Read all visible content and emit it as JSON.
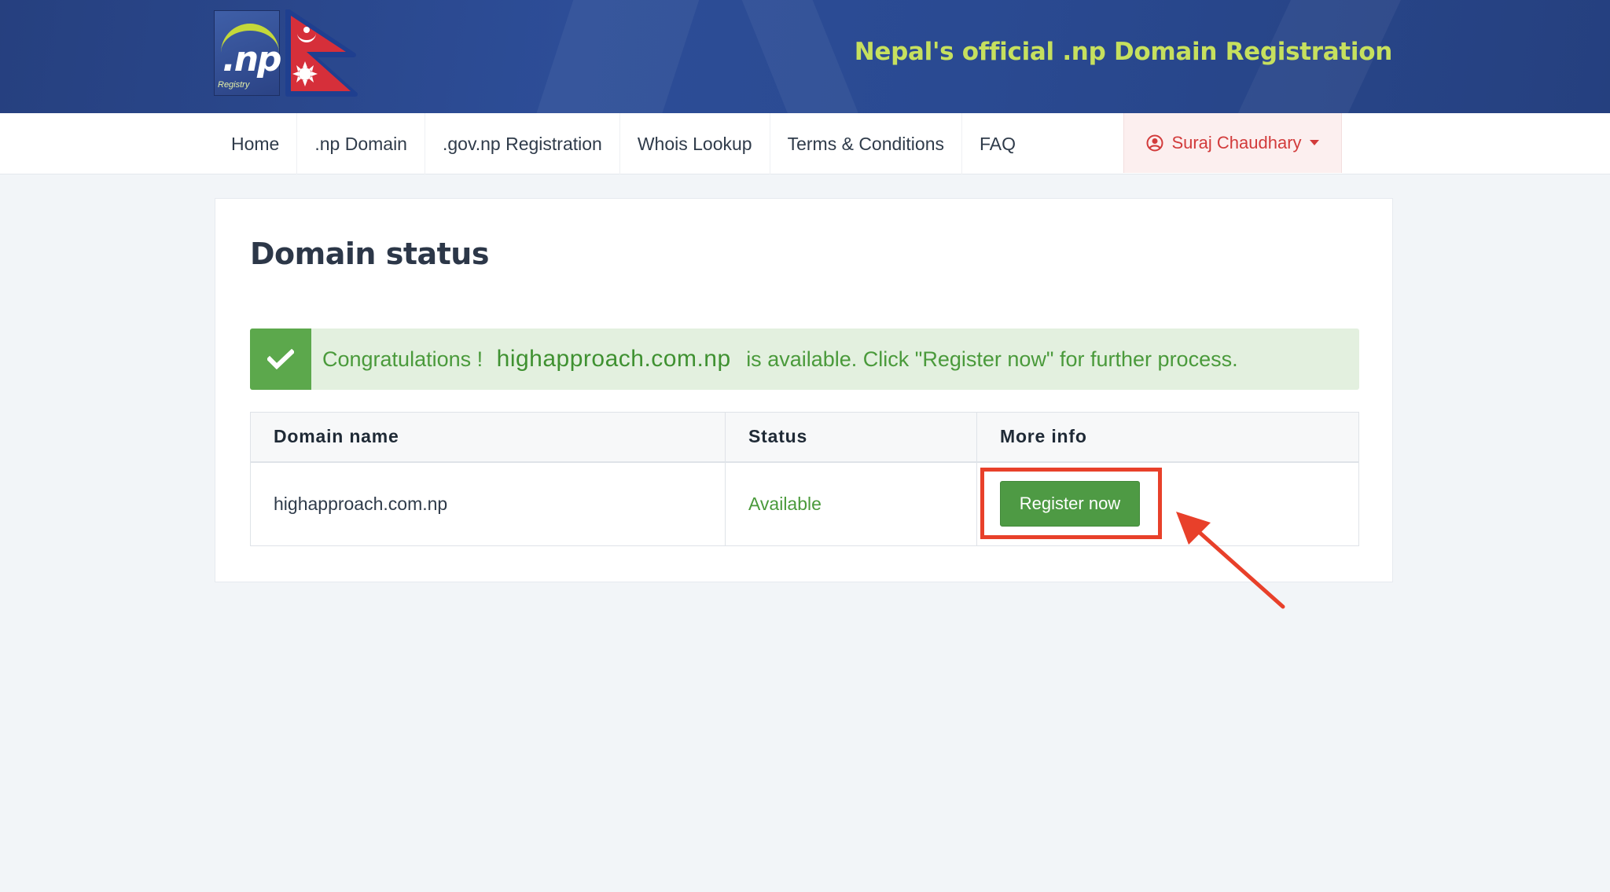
{
  "header": {
    "logo_text": ".np",
    "logo_subtext": "Registry",
    "title": "Nepal's official .np Domain Registration",
    "colors": {
      "banner": "#2a4a92",
      "title": "#c6e05e"
    }
  },
  "nav": {
    "items": [
      {
        "label": "Home"
      },
      {
        "label": ".np Domain"
      },
      {
        "label": ".gov.np Registration"
      },
      {
        "label": "Whois Lookup"
      },
      {
        "label": "Terms & Conditions"
      },
      {
        "label": "FAQ"
      }
    ],
    "user": {
      "name": "Suraj Chaudhary",
      "icon": "user-circle-icon",
      "caret": "caret-down-icon"
    }
  },
  "page": {
    "title": "Domain status"
  },
  "alert": {
    "prefix": "Congratulations !",
    "domain": "highapproach.com.np",
    "suffix": "is available. Click \"Register now\" for further process.",
    "icon": "check-icon",
    "colors": {
      "background": "#e3f0df",
      "icon_bg": "#5ca84c",
      "text": "#4a9a3b"
    }
  },
  "table": {
    "headers": {
      "domain_name": "Domain name",
      "status": "Status",
      "more_info": "More info"
    },
    "rows": [
      {
        "domain_name": "highapproach.com.np",
        "status": "Available",
        "action_label": "Register now"
      }
    ]
  },
  "annotation": {
    "highlight_color": "#e8402a"
  }
}
